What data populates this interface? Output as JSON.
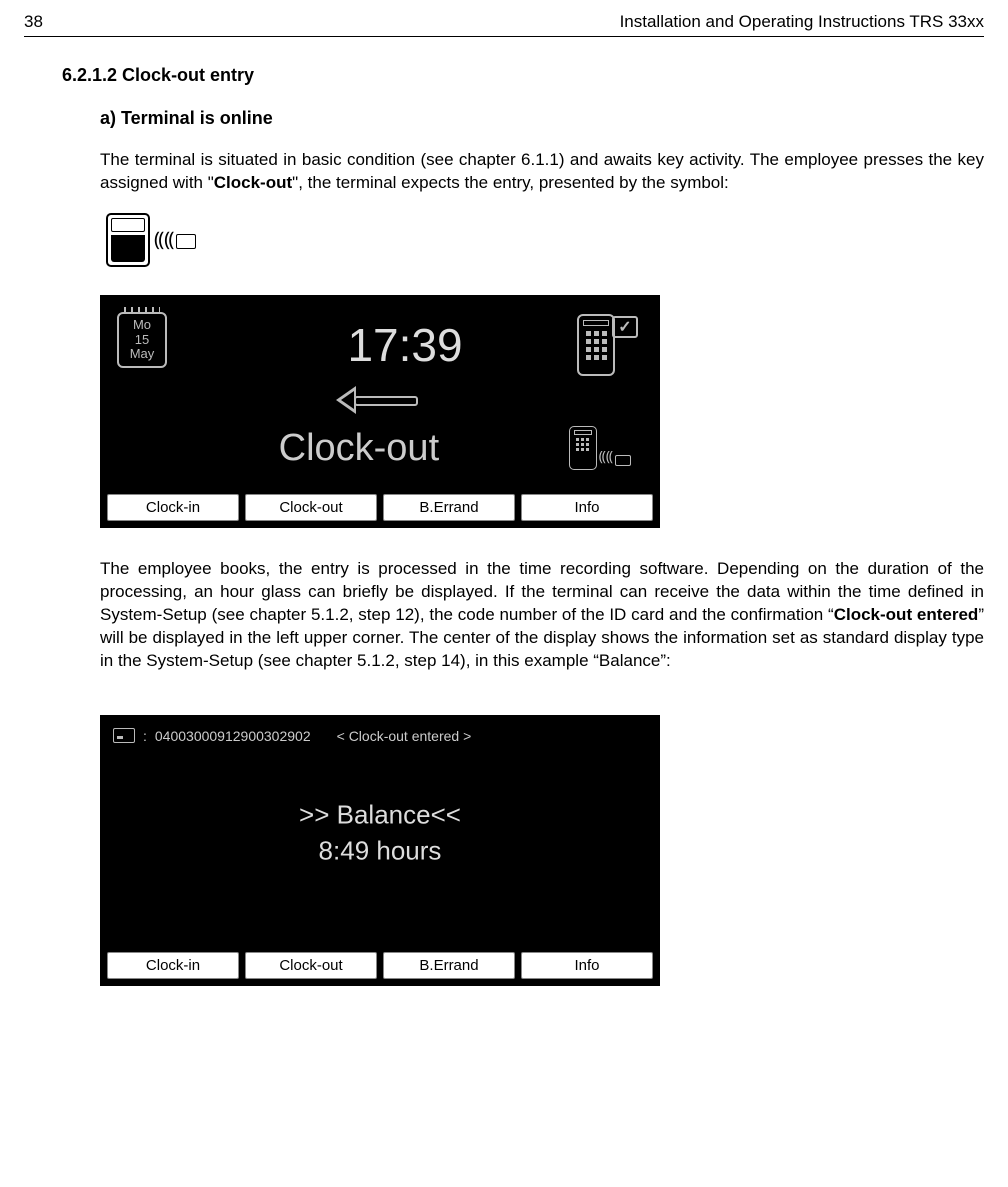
{
  "header": {
    "page_number": "38",
    "doc_title": "Installation  and Operating Instructions TRS 33xx"
  },
  "section": {
    "number_title": "6.2.1.2 Clock-out entry",
    "sub_a": "a) Terminal is online",
    "para1_a": "The terminal is situated in basic condition (see chapter 6.1.1) and awaits  key activity. The employee presses the key assigned with \"",
    "para1_bold": "Clock-out",
    "para1_b": "\", the terminal expects the entry, presented by the symbol:",
    "para2_a": "The employee books, the entry is processed in the time recording software. Depending on the duration of the processing, an hour glass can briefly be displayed. If the terminal can receive the data within the time defined in System-Setup (see chapter 5.1.2, step 12), the code number of the ID card and the confirmation “",
    "para2_bold": "Clock-out entered",
    "para2_b": "” will be displayed in the left upper corner. The center of the display shows the information set as standard display type in the System-Setup (see chapter 5.1.2, step 14), in this example “Balance”:"
  },
  "terminal1": {
    "date": {
      "dow": "Mo",
      "day": "15",
      "month": "May"
    },
    "time": "17:39",
    "mode": "Clock-out",
    "buttons": [
      "Clock-in",
      "Clock-out",
      "B.Errand",
      "Info"
    ]
  },
  "terminal2": {
    "id_label": ":",
    "id_value": "04003000912900302902",
    "confirm": "< Clock-out entered >",
    "balance_label": ">> Balance<<",
    "balance_value": "8:49 hours",
    "buttons": [
      "Clock-in",
      "Clock-out",
      "B.Errand",
      "Info"
    ]
  }
}
